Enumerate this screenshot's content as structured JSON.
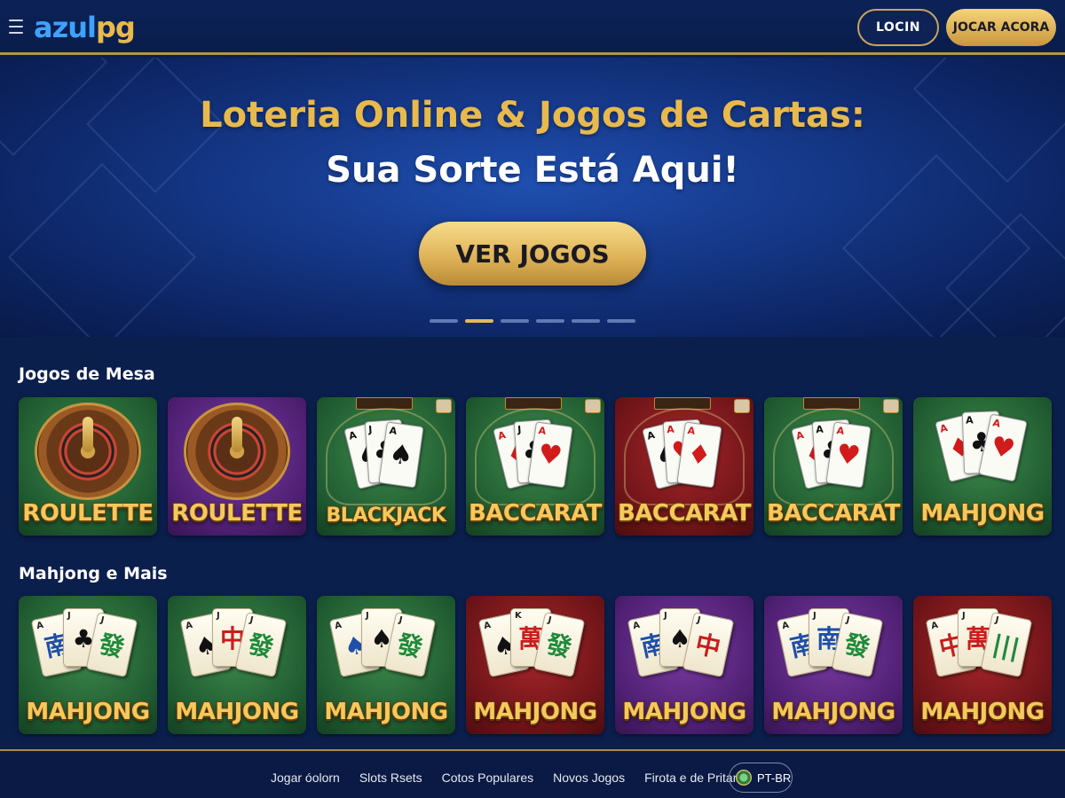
{
  "header": {
    "logo_part1": "azul",
    "logo_part2": "pg",
    "login_label": "LOCIN",
    "play_label": "JOCAR ACORA"
  },
  "hero": {
    "title_line1": "Loteria Online & Jogos de Cartas:",
    "title_line2": "Sua Sorte Está Aqui!",
    "cta_label": "VER JOGOS",
    "slides": 6,
    "active_slide": 2
  },
  "sections": [
    {
      "title": "Jogos de Mesa",
      "games": [
        {
          "label": "ROULETTE",
          "theme": "green"
        },
        {
          "label": "ROULETTE",
          "theme": "purple"
        },
        {
          "label": "BLACKJACK",
          "theme": "green"
        },
        {
          "label": "BACCARAT",
          "theme": "green"
        },
        {
          "label": "BACCARAT",
          "theme": "red"
        },
        {
          "label": "BACCARAT",
          "theme": "green"
        },
        {
          "label": "MAHJONG",
          "theme": "green"
        }
      ]
    },
    {
      "title": "Mahjong e Mais",
      "games": [
        {
          "label": "MAHJONG",
          "theme": "green"
        },
        {
          "label": "MAHJONG",
          "theme": "green"
        },
        {
          "label": "MAHJONG",
          "theme": "green"
        },
        {
          "label": "MAHJONG",
          "theme": "red"
        },
        {
          "label": "MAHJONG",
          "theme": "purple"
        },
        {
          "label": "MAHJONG",
          "theme": "purple"
        },
        {
          "label": "MAHJONG",
          "theme": "red"
        }
      ]
    }
  ],
  "footer": {
    "links": [
      "Jogar óolorn",
      "Slots Rsets",
      "Cotos Populares",
      "Novos Jogos",
      "Firota e de Pritar"
    ],
    "language": "PT-BR"
  },
  "colors": {
    "background": "#0b1f4d",
    "gold": "#e8b94d",
    "logo_blue": "#3fa2ff"
  }
}
